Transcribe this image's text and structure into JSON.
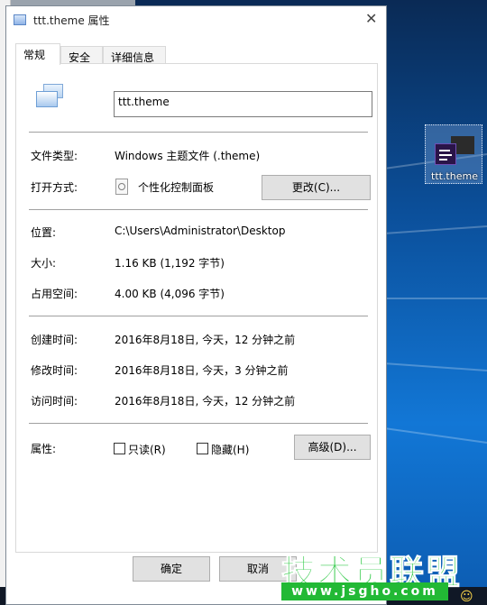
{
  "window": {
    "title": "ttt.theme 属性",
    "close_glyph": "✕"
  },
  "tabs": [
    {
      "label": "常规",
      "active": true
    },
    {
      "label": "安全",
      "active": false
    },
    {
      "label": "详细信息",
      "active": false
    }
  ],
  "general": {
    "file_name": "ttt.theme",
    "file_type_label": "文件类型:",
    "file_type_value": "Windows 主题文件 (.theme)",
    "open_with_label": "打开方式:",
    "open_with_value": "个性化控制面板",
    "change_button": "更改(C)...",
    "location_label": "位置:",
    "location_value": "C:\\Users\\Administrator\\Desktop",
    "size_label": "大小:",
    "size_value": "1.16 KB (1,192 字节)",
    "size_on_disk_label": "占用空间:",
    "size_on_disk_value": "4.00 KB (4,096 字节)",
    "created_label": "创建时间:",
    "created_value": "2016年8月18日, 今天，12 分钟之前",
    "modified_label": "修改时间:",
    "modified_value": "2016年8月18日, 今天，3 分钟之前",
    "accessed_label": "访问时间:",
    "accessed_value": "2016年8月18日, 今天，12 分钟之前",
    "attributes_label": "属性:",
    "readonly_label": "只读(R)",
    "readonly_checked": false,
    "hidden_label": "隐藏(H)",
    "hidden_checked": false,
    "advanced_button": "高级(D)..."
  },
  "footer": {
    "ok_button": "确定",
    "cancel_button": "取消"
  },
  "desktop": {
    "icon_label": "ttt.theme",
    "watermark": "技术员联盟",
    "watermark_url": "www.jsgho.com"
  },
  "colors": {
    "accent": "#0078d7",
    "watermark_green": "#23c63b"
  }
}
